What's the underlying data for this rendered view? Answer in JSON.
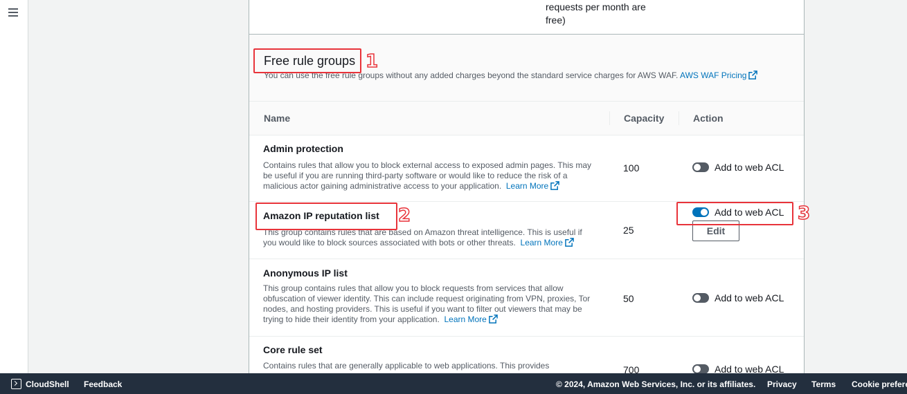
{
  "top_cell": {
    "text": "requests per month are free)"
  },
  "section": {
    "title": "Free rule groups",
    "description": "You can use the free rule groups without any added charges beyond the standard service charges for AWS WAF.",
    "pricing_link": "AWS WAF Pricing"
  },
  "table": {
    "headers": {
      "name": "Name",
      "capacity": "Capacity",
      "action": "Action"
    },
    "rows": [
      {
        "name": "Admin protection",
        "description": "Contains rules that allow you to block external access to exposed admin pages. This may be useful if you are running third-party software or would like to reduce the risk of a malicious actor gaining administrative access to your application.",
        "learn_more": "Learn More",
        "capacity": "100",
        "toggle_label": "Add to web ACL",
        "enabled": false
      },
      {
        "name": "Amazon IP reputation list",
        "description": "This group contains rules that are based on Amazon threat intelligence. This is useful if you would like to block sources associated with bots or other threats.",
        "learn_more": "Learn More",
        "capacity": "25",
        "toggle_label": "Add to web ACL",
        "enabled": true,
        "edit_label": "Edit"
      },
      {
        "name": "Anonymous IP list",
        "description": "This group contains rules that allow you to block requests from services that allow obfuscation of viewer identity. This can include request originating from VPN, proxies, Tor nodes, and hosting providers. This is useful if you want to filter out viewers that may be trying to hide their identity from your application.",
        "learn_more": "Learn More",
        "capacity": "50",
        "toggle_label": "Add to web ACL",
        "enabled": false
      },
      {
        "name": "Core rule set",
        "description": "Contains rules that are generally applicable to web applications. This provides",
        "capacity": "700",
        "toggle_label": "Add to web ACL",
        "enabled": false
      }
    ]
  },
  "annotations": {
    "one": "1",
    "two": "2",
    "three": "3"
  },
  "footer": {
    "cloudshell": "CloudShell",
    "feedback": "Feedback",
    "copyright": "© 2024, Amazon Web Services, Inc. or its affiliates.",
    "privacy": "Privacy",
    "terms": "Terms",
    "cookie": "Cookie prefere"
  },
  "colors": {
    "accent": "#0073bb",
    "annotation": "#e8333a",
    "footer_bg": "#232f3e"
  }
}
